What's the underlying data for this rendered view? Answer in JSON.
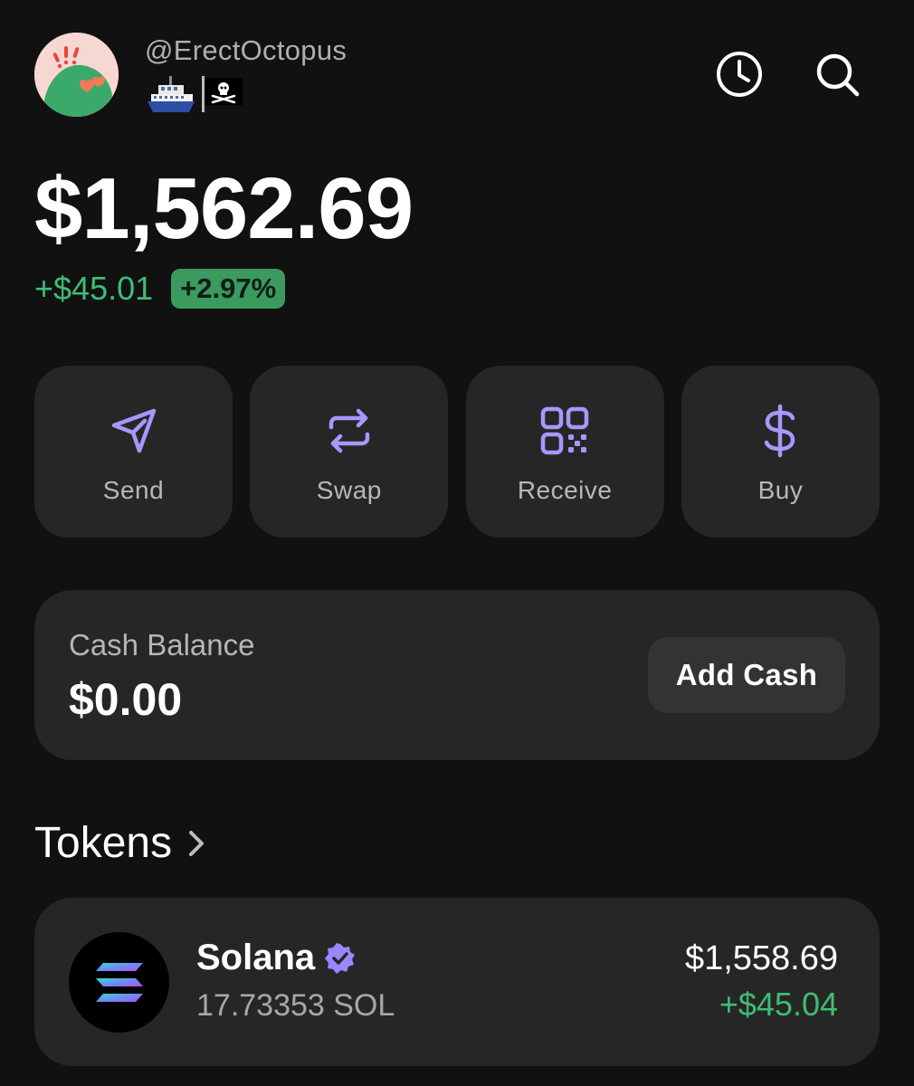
{
  "header": {
    "handle": "@ErectOctopus",
    "avatar_icon": "octopus-hearts-avatar",
    "status_emoji": [
      "ship-icon",
      "pirate-flag-icon"
    ],
    "history_icon": "clock-icon",
    "search_icon": "search-icon"
  },
  "portfolio": {
    "balance": "$1,562.69",
    "change_amount": "+$45.01",
    "change_percent": "+2.97%"
  },
  "actions": [
    {
      "label": "Send",
      "icon": "send-icon"
    },
    {
      "label": "Swap",
      "icon": "swap-icon"
    },
    {
      "label": "Receive",
      "icon": "qr-code-icon"
    },
    {
      "label": "Buy",
      "icon": "dollar-icon"
    }
  ],
  "cash": {
    "label": "Cash Balance",
    "amount": "$0.00",
    "add_button": "Add Cash"
  },
  "tokens": {
    "title": "Tokens",
    "items": [
      {
        "name": "Solana",
        "amount": "17.73353 SOL",
        "value": "$1,558.69",
        "change": "+$45.04",
        "verified": true,
        "icon": "solana-logo-icon"
      }
    ]
  },
  "colors": {
    "background": "#111111",
    "card": "#262626",
    "accent": "#a996ff",
    "positive": "#3fbd73"
  }
}
